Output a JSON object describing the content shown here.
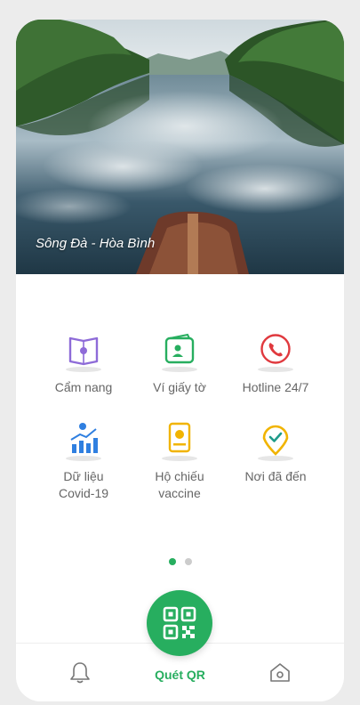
{
  "hero": {
    "caption": "Sông Đà - Hòa Bình"
  },
  "features": [
    {
      "label": "Cẩm nang",
      "icon": "guidebook-icon",
      "color": "#8e6bd8"
    },
    {
      "label": "Ví giấy tờ",
      "icon": "wallet-icon",
      "color": "#27ae5f"
    },
    {
      "label": "Hotline 24/7",
      "icon": "phone-icon",
      "color": "#e0393e"
    },
    {
      "label": "Dữ liệu\nCovid-19",
      "icon": "chart-icon",
      "color": "#2f7fe0"
    },
    {
      "label": "Hộ chiếu\nvaccine",
      "icon": "passport-icon",
      "color": "#f1b400"
    },
    {
      "label": "Nơi đã đến",
      "icon": "location-icon",
      "color": "#f1b400"
    }
  ],
  "pagination": {
    "pages": 2,
    "active": 0
  },
  "bottom_nav": {
    "qr_label": "Quét QR",
    "left_icon": "bell-icon",
    "right_icon": "home-icon",
    "accent": "#27ae5f"
  }
}
